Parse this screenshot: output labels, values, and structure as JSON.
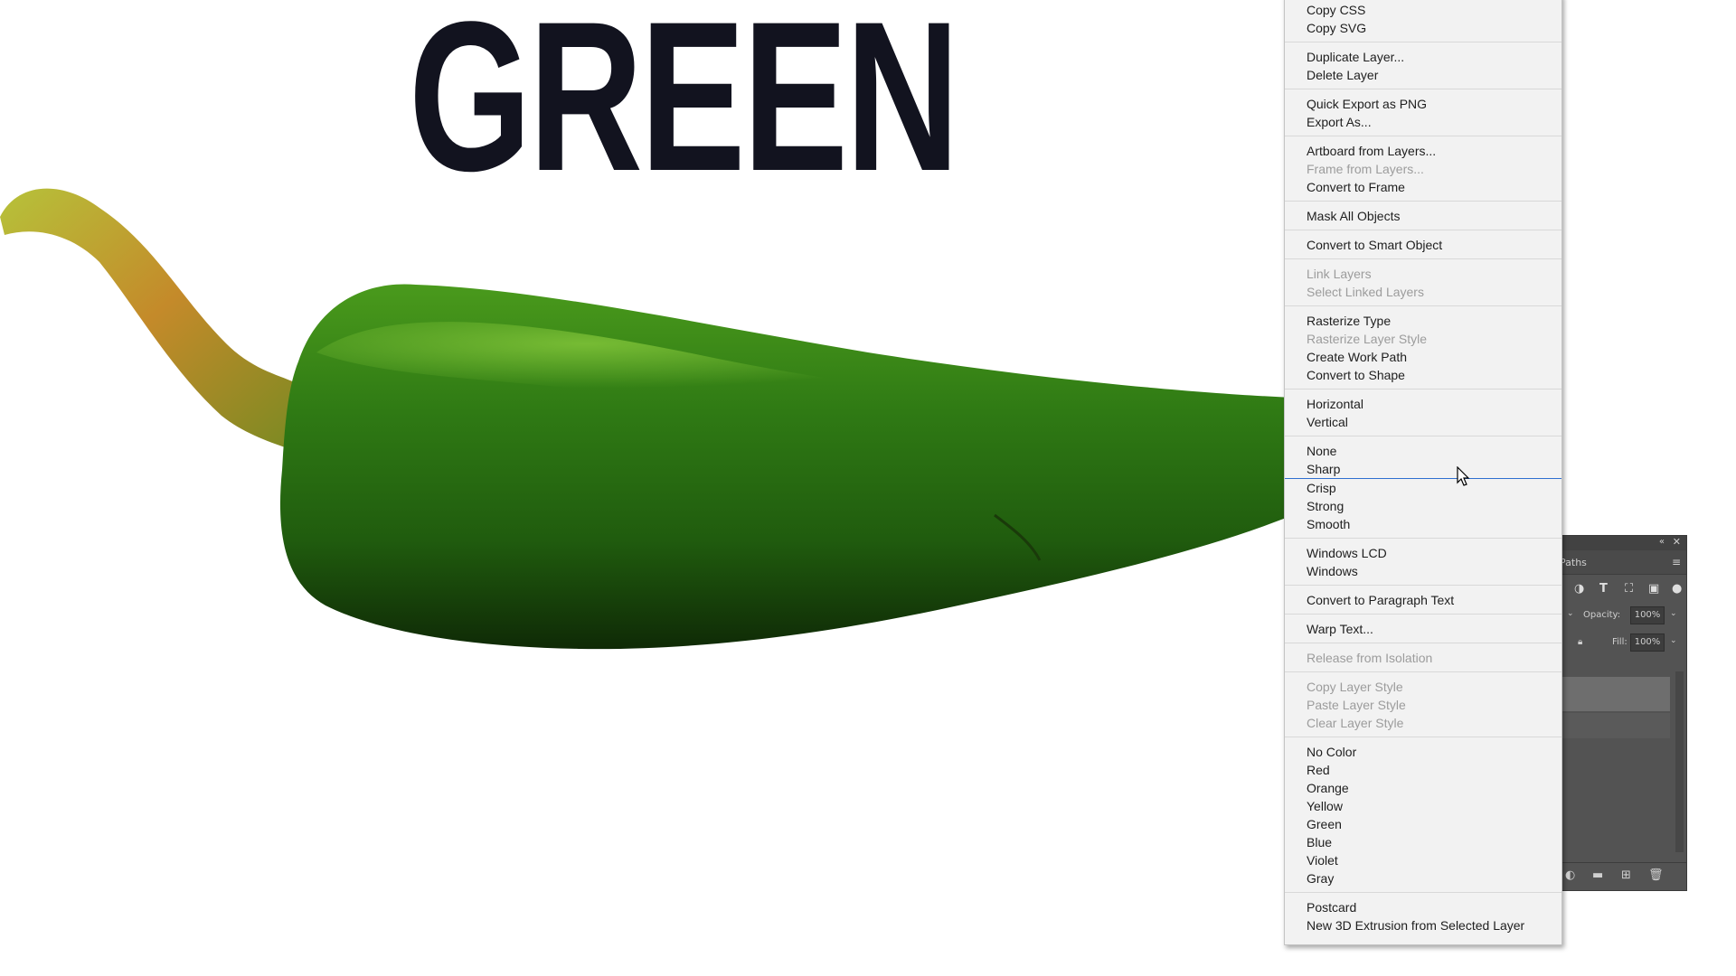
{
  "canvas": {
    "headline": "GREEN"
  },
  "context_menu": {
    "groups": [
      {
        "items": [
          {
            "label": "Copy CSS",
            "enabled": true
          },
          {
            "label": "Copy SVG",
            "enabled": true
          }
        ]
      },
      {
        "items": [
          {
            "label": "Duplicate Layer...",
            "enabled": true
          },
          {
            "label": "Delete Layer",
            "enabled": true
          }
        ]
      },
      {
        "items": [
          {
            "label": "Quick Export as PNG",
            "enabled": true
          },
          {
            "label": "Export As...",
            "enabled": true
          }
        ]
      },
      {
        "items": [
          {
            "label": "Artboard from Layers...",
            "enabled": true
          },
          {
            "label": "Frame from Layers...",
            "enabled": false
          },
          {
            "label": "Convert to Frame",
            "enabled": true
          }
        ]
      },
      {
        "items": [
          {
            "label": "Mask All Objects",
            "enabled": true
          }
        ]
      },
      {
        "items": [
          {
            "label": "Convert to Smart Object",
            "enabled": true
          }
        ]
      },
      {
        "items": [
          {
            "label": "Link Layers",
            "enabled": false
          },
          {
            "label": "Select Linked Layers",
            "enabled": false
          }
        ]
      },
      {
        "items": [
          {
            "label": "Rasterize Type",
            "enabled": true
          },
          {
            "label": "Rasterize Layer Style",
            "enabled": false
          },
          {
            "label": "Create Work Path",
            "enabled": true
          },
          {
            "label": "Convert to Shape",
            "enabled": true
          }
        ]
      },
      {
        "items": [
          {
            "label": "Horizontal",
            "enabled": true
          },
          {
            "label": "Vertical",
            "enabled": true
          }
        ]
      },
      {
        "items": [
          {
            "label": "None",
            "enabled": true
          },
          {
            "label": "Sharp",
            "enabled": true,
            "hovered": true
          },
          {
            "label": "Crisp",
            "enabled": true
          },
          {
            "label": "Strong",
            "enabled": true
          },
          {
            "label": "Smooth",
            "enabled": true
          }
        ]
      },
      {
        "items": [
          {
            "label": "Windows LCD",
            "enabled": true
          },
          {
            "label": "Windows",
            "enabled": true
          }
        ]
      },
      {
        "items": [
          {
            "label": "Convert to Paragraph Text",
            "enabled": true
          }
        ]
      },
      {
        "items": [
          {
            "label": "Warp Text...",
            "enabled": true
          }
        ]
      },
      {
        "items": [
          {
            "label": "Release from Isolation",
            "enabled": false
          }
        ]
      },
      {
        "items": [
          {
            "label": "Copy Layer Style",
            "enabled": false
          },
          {
            "label": "Paste Layer Style",
            "enabled": false
          },
          {
            "label": "Clear Layer Style",
            "enabled": false
          }
        ]
      },
      {
        "items": [
          {
            "label": "No Color",
            "enabled": true
          },
          {
            "label": "Red",
            "enabled": true
          },
          {
            "label": "Orange",
            "enabled": true
          },
          {
            "label": "Yellow",
            "enabled": true
          },
          {
            "label": "Green",
            "enabled": true
          },
          {
            "label": "Blue",
            "enabled": true
          },
          {
            "label": "Violet",
            "enabled": true
          },
          {
            "label": "Gray",
            "enabled": true
          }
        ]
      },
      {
        "items": [
          {
            "label": "Postcard",
            "enabled": true
          },
          {
            "label": "New 3D Extrusion from Selected Layer",
            "enabled": true
          }
        ]
      }
    ]
  },
  "layers_panel": {
    "tab_label": "Paths",
    "opacity_label": "Opacity:",
    "opacity_value": "100%",
    "fill_label": "Fill:",
    "fill_value": "100%",
    "filter_icons": [
      "adjustment-filter-icon",
      "type-filter-icon",
      "shape-filter-icon",
      "smart-object-filter-icon"
    ],
    "footer_icons": [
      "adjustment-layer-icon",
      "group-folder-icon",
      "new-layer-icon",
      "delete-layer-icon"
    ]
  },
  "colors": {
    "headline": "#12131f",
    "menu_bg": "#f2f2f2",
    "menu_hover_line": "#2f6fd0",
    "panel_bg": "#535353"
  }
}
